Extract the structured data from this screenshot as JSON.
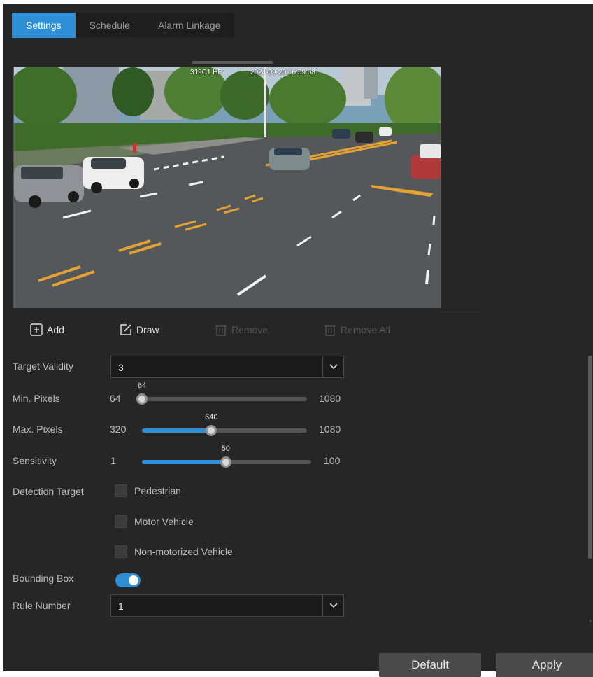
{
  "tabs": [
    {
      "label": "Settings",
      "active": true
    },
    {
      "label": "Schedule",
      "active": false
    },
    {
      "label": "Alarm Linkage",
      "active": false
    }
  ],
  "video": {
    "osd_channel": "319C1 HP",
    "osd_timestamp": "2024-09-20 16:59:58"
  },
  "toolbar": {
    "add": "Add",
    "draw": "Draw",
    "remove": "Remove",
    "remove_all": "Remove All"
  },
  "form": {
    "target_validity": {
      "label": "Target Validity",
      "value": "3"
    },
    "min_pixels": {
      "label": "Min. Pixels",
      "min": "64",
      "max": "1080",
      "value": "64"
    },
    "max_pixels": {
      "label": "Max. Pixels",
      "min": "320",
      "max": "1080",
      "value": "640"
    },
    "sensitivity": {
      "label": "Sensitivity",
      "min": "1",
      "max": "100",
      "value": "50"
    },
    "detection_target": {
      "label": "Detection Target",
      "options": [
        {
          "label": "Pedestrian",
          "checked": false
        },
        {
          "label": "Motor Vehicle",
          "checked": false
        },
        {
          "label": "Non-motorized Vehicle",
          "checked": false
        }
      ]
    },
    "bounding_box": {
      "label": "Bounding Box",
      "enabled": true
    },
    "rule_number": {
      "label": "Rule Number",
      "value": "1"
    }
  },
  "buttons": {
    "default": "Default",
    "apply": "Apply"
  },
  "colors": {
    "accent": "#2e8fd6",
    "panel": "#262626"
  }
}
